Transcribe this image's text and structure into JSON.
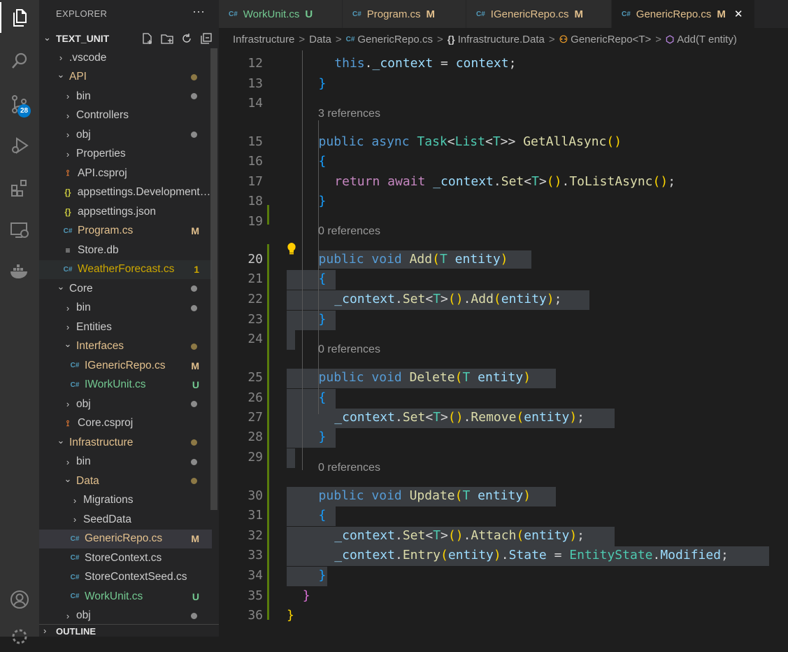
{
  "activity_bar": {
    "scm_badge": "28"
  },
  "explorer": {
    "title": "EXPLORER",
    "more": "···",
    "section": "TEXT_UNIT",
    "outline": "OUTLINE",
    "tree": [
      {
        "label": ".vscode",
        "type": "folder",
        "open": false,
        "depth": 0
      },
      {
        "label": "API",
        "type": "folder",
        "open": true,
        "depth": 0,
        "color": "#e2c08d",
        "dot": "#8c7845"
      },
      {
        "label": "bin",
        "type": "folder",
        "open": false,
        "depth": 1,
        "dot": "#8b8b8b"
      },
      {
        "label": "Controllers",
        "type": "folder",
        "open": false,
        "depth": 1
      },
      {
        "label": "obj",
        "type": "folder",
        "open": false,
        "depth": 1,
        "dot": "#8b8b8b"
      },
      {
        "label": "Properties",
        "type": "folder",
        "open": false,
        "depth": 1
      },
      {
        "label": "API.csproj",
        "type": "rss",
        "depth": 1
      },
      {
        "label": "appsettings.Development.j...",
        "type": "json",
        "depth": 1
      },
      {
        "label": "appsettings.json",
        "type": "json",
        "depth": 1
      },
      {
        "label": "Program.cs",
        "type": "cs",
        "depth": 1,
        "color": "#e2c08d",
        "status": "M",
        "statusColor": "#e2c08d"
      },
      {
        "label": "Store.db",
        "type": "db",
        "depth": 1
      },
      {
        "label": "WeatherForecast.cs",
        "type": "cs",
        "depth": 1,
        "color": "#cca700",
        "status": "1",
        "statusColor": "#cca700",
        "hover": true
      },
      {
        "label": "Core",
        "type": "folder",
        "open": true,
        "depth": 0,
        "dot": "#8b8b8b"
      },
      {
        "label": "bin",
        "type": "folder",
        "open": false,
        "depth": 1,
        "dot": "#8b8b8b"
      },
      {
        "label": "Entities",
        "type": "folder",
        "open": false,
        "depth": 1
      },
      {
        "label": "Interfaces",
        "type": "folder",
        "open": true,
        "depth": 1,
        "color": "#e2c08d",
        "dot": "#8c7845"
      },
      {
        "label": "IGenericRepo.cs",
        "type": "cs",
        "depth": 2,
        "color": "#e2c08d",
        "status": "M",
        "statusColor": "#e2c08d"
      },
      {
        "label": "IWorkUnit.cs",
        "type": "cs",
        "depth": 2,
        "color": "#73c991",
        "status": "U",
        "statusColor": "#73c991"
      },
      {
        "label": "obj",
        "type": "folder",
        "open": false,
        "depth": 1,
        "dot": "#8b8b8b"
      },
      {
        "label": "Core.csproj",
        "type": "rss",
        "depth": 1
      },
      {
        "label": "Infrastructure",
        "type": "folder",
        "open": true,
        "depth": 0,
        "color": "#e2c08d",
        "dot": "#8c7845"
      },
      {
        "label": "bin",
        "type": "folder",
        "open": false,
        "depth": 1,
        "dot": "#8b8b8b"
      },
      {
        "label": "Data",
        "type": "folder",
        "open": true,
        "depth": 1,
        "color": "#e2c08d",
        "dot": "#8c7845"
      },
      {
        "label": "Migrations",
        "type": "folder",
        "open": false,
        "depth": 2
      },
      {
        "label": "SeedData",
        "type": "folder",
        "open": false,
        "depth": 2
      },
      {
        "label": "GenericRepo.cs",
        "type": "cs",
        "depth": 2,
        "color": "#e2c08d",
        "status": "M",
        "statusColor": "#e2c08d",
        "selected": true
      },
      {
        "label": "StoreContext.cs",
        "type": "cs",
        "depth": 2
      },
      {
        "label": "StoreContextSeed.cs",
        "type": "cs",
        "depth": 2
      },
      {
        "label": "WorkUnit.cs",
        "type": "cs",
        "depth": 2,
        "color": "#73c991",
        "status": "U",
        "statusColor": "#73c991"
      },
      {
        "label": "obj",
        "type": "folder",
        "open": false,
        "depth": 1,
        "dot": "#8b8b8b"
      }
    ]
  },
  "tabs": [
    {
      "label": "WorkUnit.cs",
      "status": "U",
      "color": "#73c991"
    },
    {
      "label": "Program.cs",
      "status": "M",
      "color": "#e2c08d"
    },
    {
      "label": "IGenericRepo.cs",
      "status": "M",
      "color": "#e2c08d"
    },
    {
      "label": "GenericRepo.cs",
      "status": "M",
      "color": "#e2c08d",
      "active": true
    }
  ],
  "breadcrumbs": {
    "items": [
      "Infrastructure",
      "Data",
      "GenericRepo.cs",
      "Infrastructure.Data",
      "GenericRepo<T>",
      "Add(T entity)"
    ],
    "sep": ">"
  },
  "editor": {
    "lens": [
      "3 references",
      "0 references",
      "0 references",
      "0 references"
    ],
    "current_line": "20",
    "lines": [
      {
        "n": "12",
        "text": "this._context = context;"
      },
      {
        "n": "13",
        "text": "}"
      },
      {
        "n": "14",
        "text": ""
      },
      {
        "n": "15",
        "text": "public async Task<List<T>> GetAllAsync()"
      },
      {
        "n": "16",
        "text": "{"
      },
      {
        "n": "17",
        "text": "return await _context.Set<T>().ToListAsync();"
      },
      {
        "n": "18",
        "text": "}"
      },
      {
        "n": "19",
        "text": ""
      },
      {
        "n": "20",
        "text": "public void Add(T entity)"
      },
      {
        "n": "21",
        "text": "{"
      },
      {
        "n": "22",
        "text": "_context.Set<T>().Add(entity);"
      },
      {
        "n": "23",
        "text": "}"
      },
      {
        "n": "24",
        "text": ""
      },
      {
        "n": "25",
        "text": "public void Delete(T entity)"
      },
      {
        "n": "26",
        "text": "{"
      },
      {
        "n": "27",
        "text": "_context.Set<T>().Remove(entity);"
      },
      {
        "n": "28",
        "text": "}"
      },
      {
        "n": "29",
        "text": ""
      },
      {
        "n": "30",
        "text": "public void Update(T entity)"
      },
      {
        "n": "31",
        "text": "{"
      },
      {
        "n": "32",
        "text": "_context.Set<T>().Attach(entity);"
      },
      {
        "n": "33",
        "text": "_context.Entry(entity).State = EntityState.Modified;"
      },
      {
        "n": "34",
        "text": "}"
      },
      {
        "n": "35",
        "text": "}"
      },
      {
        "n": "36",
        "text": "}"
      }
    ]
  }
}
